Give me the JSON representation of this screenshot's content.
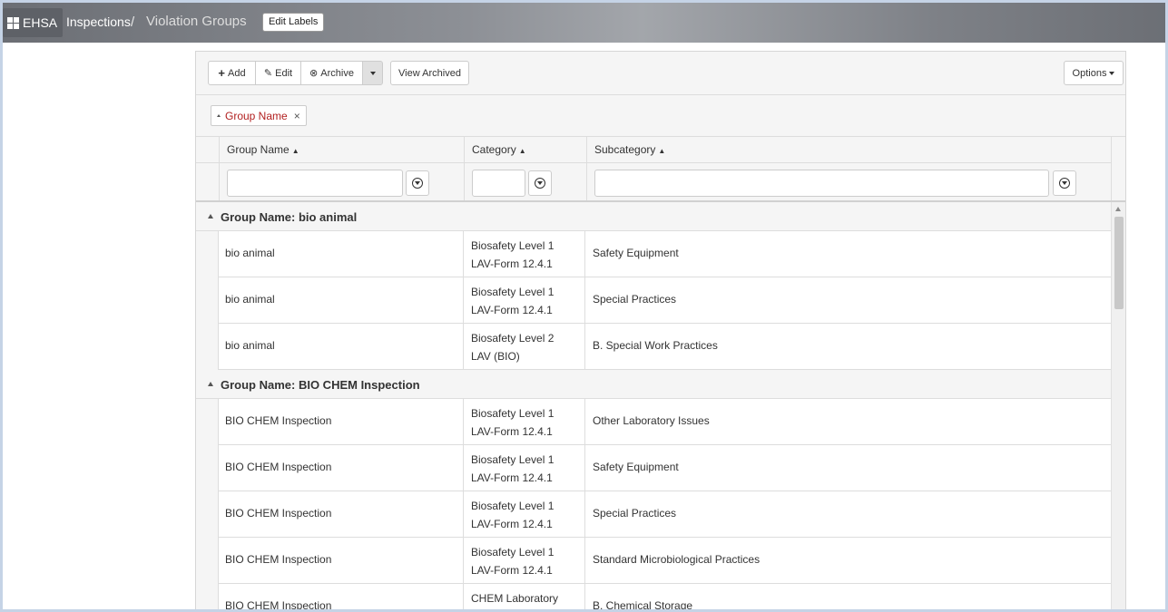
{
  "header": {
    "brand": "EHSA",
    "breadcrumb_inspections": "Inspections",
    "breadcrumb_separator": "/",
    "breadcrumb_current": "Violation Groups",
    "edit_labels": "Edit Labels"
  },
  "toolbar": {
    "add": "Add",
    "edit": "Edit",
    "archive": "Archive",
    "view_archived": "View Archived",
    "options": "Options"
  },
  "grouping": {
    "chip_label": "Group Name"
  },
  "columns": {
    "group_name": "Group Name",
    "category": "Category",
    "subcategory": "Subcategory"
  },
  "groups": [
    {
      "label": "Group Name: bio animal",
      "rows": [
        {
          "group_name": "bio animal",
          "category_line1": "Biosafety Level 1",
          "category_line2": "LAV-Form 12.4.1",
          "subcategory": "Safety Equipment"
        },
        {
          "group_name": "bio animal",
          "category_line1": "Biosafety Level 1",
          "category_line2": "LAV-Form 12.4.1",
          "subcategory": "Special Practices"
        },
        {
          "group_name": "bio animal",
          "category_line1": "Biosafety Level 2",
          "category_line2": "LAV (BIO)",
          "subcategory": "B. Special Work Practices"
        }
      ]
    },
    {
      "label": "Group Name: BIO CHEM Inspection",
      "rows": [
        {
          "group_name": "BIO CHEM Inspection",
          "category_line1": "Biosafety Level 1",
          "category_line2": "LAV-Form 12.4.1",
          "subcategory": "Other Laboratory Issues"
        },
        {
          "group_name": "BIO CHEM Inspection",
          "category_line1": "Biosafety Level 1",
          "category_line2": "LAV-Form 12.4.1",
          "subcategory": "Safety Equipment"
        },
        {
          "group_name": "BIO CHEM Inspection",
          "category_line1": "Biosafety Level 1",
          "category_line2": "LAV-Form 12.4.1",
          "subcategory": "Special Practices"
        },
        {
          "group_name": "BIO CHEM Inspection",
          "category_line1": "Biosafety Level 1",
          "category_line2": "LAV-Form 12.4.1",
          "subcategory": "Standard Microbiological Practices"
        },
        {
          "group_name": "BIO CHEM Inspection",
          "category_line1": "CHEM Laboratory",
          "category_line2": "",
          "subcategory": "B. Chemical Storage"
        }
      ]
    }
  ]
}
